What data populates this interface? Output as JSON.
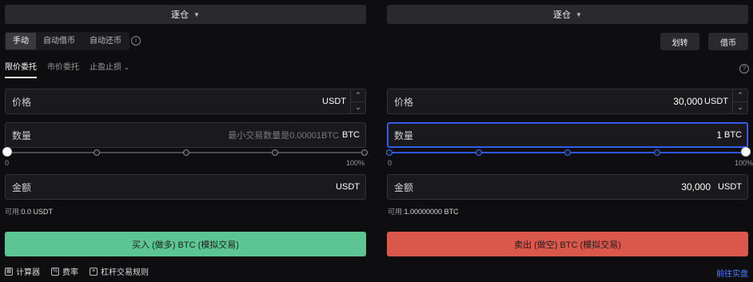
{
  "colors": {
    "buy": "#5cc593",
    "sell": "#d9584b",
    "focus": "#3f6bff",
    "link": "#4e83ff"
  },
  "left": {
    "mode": {
      "label": "逐仓",
      "icon": "caret-down-icon"
    },
    "segments": [
      "手动",
      "自动借币",
      "自动还币"
    ],
    "segment_active": "手动",
    "order_tabs": [
      "限价委托",
      "市价委托",
      "止盈止损"
    ],
    "order_tab_active": "限价委托",
    "price": {
      "label": "价格",
      "value": "",
      "unit": "USDT"
    },
    "amount": {
      "label": "数量",
      "placeholder": "最小交易数量是0.00001BTC",
      "unit": "BTC"
    },
    "slider": {
      "min_label": "0",
      "max_label": "100%",
      "value_percent": 0
    },
    "total": {
      "label": "金额",
      "value": "",
      "unit": "USDT"
    },
    "available": {
      "label": "可用:",
      "value": "0.0 USDT"
    },
    "submit_label": "买入 (做多) BTC (模拟交易)"
  },
  "right": {
    "mode": {
      "label": "逐仓",
      "icon": "caret-down-icon"
    },
    "transfer_label": "划转",
    "borrow_label": "借币",
    "price": {
      "label": "价格",
      "value": "30,000",
      "unit": "USDT"
    },
    "amount": {
      "label": "数量",
      "value": "1",
      "unit": "BTC"
    },
    "slider": {
      "min_label": "0",
      "max_label": "100%",
      "value_percent": 100
    },
    "total": {
      "label": "金额",
      "value": "30,000",
      "unit": "USDT"
    },
    "available": {
      "label": "可用:",
      "value": "1.00000000 BTC"
    },
    "submit_label": "卖出 (做空) BTC (模拟交易)"
  },
  "footer": {
    "calculator_label": "计算器",
    "fee_label": "费率",
    "rules_label": "杠杆交易规则",
    "live_link": "前往实盘"
  }
}
